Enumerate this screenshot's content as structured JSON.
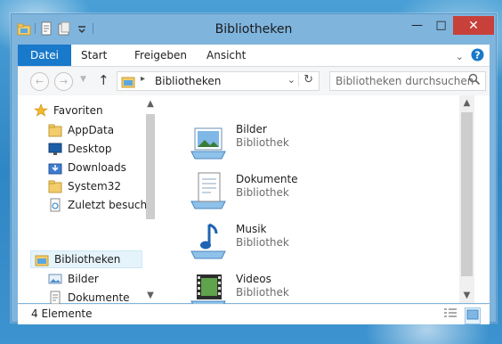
{
  "window": {
    "title": "Bibliotheken"
  },
  "ribbon": {
    "tabs": [
      {
        "label": "Datei",
        "active": true
      },
      {
        "label": "Start"
      },
      {
        "label": "Freigeben"
      },
      {
        "label": "Ansicht"
      }
    ]
  },
  "address": {
    "path": "Bibliotheken"
  },
  "search": {
    "placeholder": "Bibliotheken durchsuchen"
  },
  "navpane": {
    "favorites_label": "Favoriten",
    "favorites": [
      {
        "label": "AppData",
        "icon": "folder-icon"
      },
      {
        "label": "Desktop",
        "icon": "desktop-icon"
      },
      {
        "label": "Downloads",
        "icon": "downloads-icon"
      },
      {
        "label": "System32",
        "icon": "folder-icon"
      },
      {
        "label": "Zuletzt besucht",
        "icon": "recent-places-icon"
      }
    ],
    "libraries_label": "Bibliotheken",
    "libraries": [
      {
        "label": "Bilder",
        "icon": "pictures-icon"
      },
      {
        "label": "Dokumente",
        "icon": "documents-icon"
      }
    ]
  },
  "content": {
    "items": [
      {
        "name": "Bilder",
        "type": "Bibliothek",
        "icon": "pictures-library-icon"
      },
      {
        "name": "Dokumente",
        "type": "Bibliothek",
        "icon": "documents-library-icon"
      },
      {
        "name": "Musik",
        "type": "Bibliothek",
        "icon": "music-library-icon"
      },
      {
        "name": "Videos",
        "type": "Bibliothek",
        "icon": "videos-library-icon"
      }
    ]
  },
  "status": {
    "count": "4 Elemente"
  },
  "colors": {
    "accent": "#1979ca",
    "close": "#c7403a",
    "frame": "#7fb4dd"
  }
}
